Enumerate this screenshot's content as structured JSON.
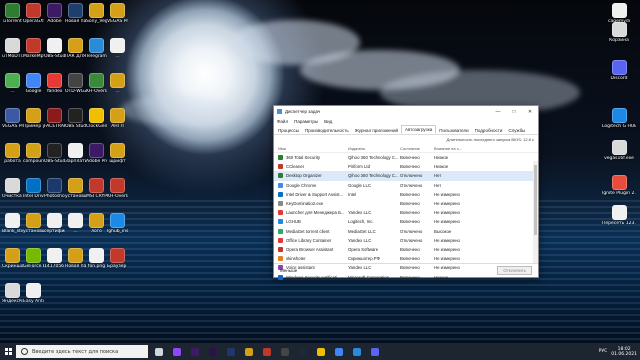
{
  "desktop_icons_left": [
    {
      "label": "uTorrent",
      "color": "#2e7d32"
    },
    {
      "label": "OperaGXSet...",
      "color": "#c0392b"
    },
    {
      "label": "Adobe",
      "color": "#3c1a66"
    },
    {
      "label": "Новая папка (7).exe",
      "color": "#1e3f6d"
    },
    {
      "label": "Sony_Vegas...",
      "color": "#d4a017"
    },
    {
      "label": "VEGAS Pro 16.0.zip",
      "color": "#d4a017"
    },
    {
      "label": "uTMoDTI...",
      "color": "#d9d9d9"
    },
    {
      "label": "MarkeMpv Setup 2...",
      "color": "#c0392b"
    },
    {
      "label": "OBS-Studio-26...",
      "color": "#f0f0f0"
    },
    {
      "label": "ПАК ДЛЯ ШАПКИ...",
      "color": "#d4a017"
    },
    {
      "label": "Telegram",
      "color": "#2a8bd8"
    },
    {
      "label": "...",
      "color": "#f0f0f0"
    },
    {
      "label": "...",
      "color": "#4caf50"
    },
    {
      "label": "Google",
      "color": "#4285f4"
    },
    {
      "label": "Yandex",
      "color": "#e53935"
    },
    {
      "label": "OTD-WG2...",
      "color": "#444"
    },
    {
      "label": "KH-Overlay",
      "color": "#3a8a3a"
    },
    {
      "label": "...",
      "color": "#d4a017"
    },
    {
      "label": "VEGAS Pro 14.0",
      "color": "#3b5aa3"
    },
    {
      "label": "Пример установки",
      "color": "#d4a017"
    },
    {
      "label": "FACETRAF RS",
      "color": "#8b1a1a"
    },
    {
      "label": "OBS Studio",
      "color": "#222"
    },
    {
      "label": "ClockGen",
      "color": "#f0c000"
    },
    {
      "label": "АНГЛ",
      "color": "#d4a017"
    },
    {
      "label": "работа",
      "color": "#d4a017"
    },
    {
      "label": "compound...",
      "color": "#d4a017"
    },
    {
      "label": "OBS-Studio...",
      "color": "#222"
    },
    {
      "label": "Зарплаты",
      "color": "#f0f0f0"
    },
    {
      "label": "Adobe Premiere P...",
      "color": "#3c1a66"
    },
    {
      "label": "шрифт",
      "color": "#d4a017"
    },
    {
      "label": "Очистка временных...",
      "color": "#d9d9d9"
    },
    {
      "label": "Intel Driver & Support...",
      "color": "#0071c5"
    },
    {
      "label": "Photoshop...",
      "color": "#1b3a6b"
    },
    {
      "label": "установщик для видео",
      "color": "#d4a017"
    },
    {
      "label": "MSI CRYPT...",
      "color": "#c0392b"
    },
    {
      "label": "KH-Overlay",
      "color": "#c0392b"
    },
    {
      "label": "Blank_stic...",
      "color": "#f0f0f0"
    },
    {
      "label": "установщик по...",
      "color": "#d4a017"
    },
    {
      "label": "сертифик...",
      "color": "#f0f0f0"
    },
    {
      "label": "...",
      "color": "#f0f0f0"
    },
    {
      "label": "лого",
      "color": "#d4a017"
    },
    {
      "label": "lghub_ins...",
      "color": "#1e88e5"
    },
    {
      "label": "Скриншоты",
      "color": "#d4a017"
    },
    {
      "label": "GeForce Experience",
      "color": "#76b900"
    },
    {
      "label": "1417056712",
      "color": "#f0f0f0"
    },
    {
      "label": "Новая папка",
      "color": "#d4a017"
    },
    {
      "label": "fon.png",
      "color": "#f0f0f0"
    },
    {
      "label": "Браузер Opera GX",
      "color": "#c0392b"
    },
    {
      "label": "ЯндексКП",
      "color": "#d9d9d9"
    },
    {
      "label": "Easy Anticheat",
      "color": "#f0f0f0"
    }
  ],
  "desktop_icons_right": [
    {
      "label": "cagemydi",
      "color": "#f0f0f0"
    },
    {
      "label": "Корзина",
      "color": "#d9d9d9"
    },
    {
      "label": "Discord",
      "color": "#5865f2"
    },
    {
      "label": "Logitech G HUB",
      "color": "#1e88e5"
    },
    {
      "label": "vegas16f.exe",
      "color": "#d9d9d9"
    },
    {
      "label": "Ignite Plugin 2.0",
      "color": "#e74c3c"
    },
    {
      "label": "Пересеть 123.mp4",
      "color": "#f0f0f0"
    }
  ],
  "window": {
    "title": "Диспетчер задач",
    "controls": [
      "—",
      "□",
      "✕"
    ],
    "menu": [
      "Файл",
      "Параметры",
      "Вид"
    ],
    "tabs": [
      "Процессы",
      "Производительность",
      "Журнал приложений",
      "Автозагрузка",
      "Пользователи",
      "Подробности",
      "Службы"
    ],
    "active_tab": "Автозагрузка",
    "bios_text": "Длительность последнего запуска BIOS: 12.8 с",
    "columns": [
      "Имя",
      "Издатель",
      "Состояние",
      "Влияние на з..."
    ],
    "rows": [
      {
        "name": "360 Total Security",
        "publisher": "Qihoo 360 Technology C...",
        "status": "Включено",
        "impact": "Низкое",
        "icon": "#2e7d32",
        "selected": false
      },
      {
        "name": "CCleaner",
        "publisher": "Piriform Ltd",
        "status": "Включено",
        "impact": "Низкое",
        "icon": "#c0392b",
        "selected": false
      },
      {
        "name": "Desktop Organizer",
        "publisher": "Qihoo 360 Technology C...",
        "status": "Отключено",
        "impact": "Нет",
        "icon": "#2e7d32",
        "selected": true
      },
      {
        "name": "Google Chrome",
        "publisher": "Google LLC",
        "status": "Отключено",
        "impact": "Нет",
        "icon": "#4285f4",
        "selected": false
      },
      {
        "name": "Intel Driver & Support Assist...",
        "publisher": "Intel",
        "status": "Включено",
        "impact": "Не измерено",
        "icon": "#0071c5",
        "selected": false
      },
      {
        "name": "KeyDominatio2.exe",
        "publisher": "",
        "status": "Включено",
        "impact": "Не измерено",
        "icon": "#888",
        "selected": false
      },
      {
        "name": "Launcher для Менеджера Б...",
        "publisher": "Yandex LLC",
        "status": "Включено",
        "impact": "Не измерено",
        "icon": "#e53935",
        "selected": false
      },
      {
        "name": "LGHUB",
        "publisher": "Logitech, Inc.",
        "status": "Включено",
        "impact": "Не измерено",
        "icon": "#1e88e5",
        "selected": false
      },
      {
        "name": "MediaGet torrent client",
        "publisher": "MediaGet LLC",
        "status": "Отключено",
        "impact": "Высокое",
        "icon": "#27ae60",
        "selected": false
      },
      {
        "name": "Office Library Container",
        "publisher": "Yandex LLC",
        "status": "Отключено",
        "impact": "Не измерено",
        "icon": "#e53935",
        "selected": false
      },
      {
        "name": "Opera Browser Assistant",
        "publisher": "Opera Software",
        "status": "Включено",
        "impact": "Не измерено",
        "icon": "#c0392b",
        "selected": false
      },
      {
        "name": "skinshoter",
        "publisher": "Скриншотер.РФ",
        "status": "Включено",
        "impact": "Не измерено",
        "icon": "#e67e22",
        "selected": false
      },
      {
        "name": "Voice assistant",
        "publisher": "Yandex LLC",
        "status": "Включено",
        "impact": "Не измерено",
        "icon": "#8e44ad",
        "selected": false
      },
      {
        "name": "Windows Security notificati...",
        "publisher": "Microsoft Corporation",
        "status": "Включено",
        "impact": "Низкое",
        "icon": "#1565c0",
        "selected": false
      }
    ],
    "footer_less": "Меньше",
    "footer_button": "Отключить"
  },
  "taskbar": {
    "search_placeholder": "Введите здесь текст для поиска",
    "apps": [
      {
        "name": "task-view",
        "color": "#cfd8dc"
      },
      {
        "name": "twitch",
        "color": "#9146ff"
      },
      {
        "name": "premiere",
        "color": "#3c1a66"
      },
      {
        "name": "premiere-2",
        "color": "#2a1447"
      },
      {
        "name": "photoshop",
        "color": "#1b3a6b"
      },
      {
        "name": "explorer",
        "color": "#d4a017"
      },
      {
        "name": "opera-gx",
        "color": "#c0392b"
      },
      {
        "name": "obs",
        "color": "#444"
      },
      {
        "name": "steam",
        "color": "#1b2838"
      },
      {
        "name": "yandex-music",
        "color": "#f0c000"
      },
      {
        "name": "chrome",
        "color": "#4285f4"
      },
      {
        "name": "telegram",
        "color": "#2a8bd8"
      },
      {
        "name": "discord",
        "color": "#5865f2"
      }
    ],
    "language": "РУС",
    "time": "18:02",
    "date": "01.06.2021"
  }
}
